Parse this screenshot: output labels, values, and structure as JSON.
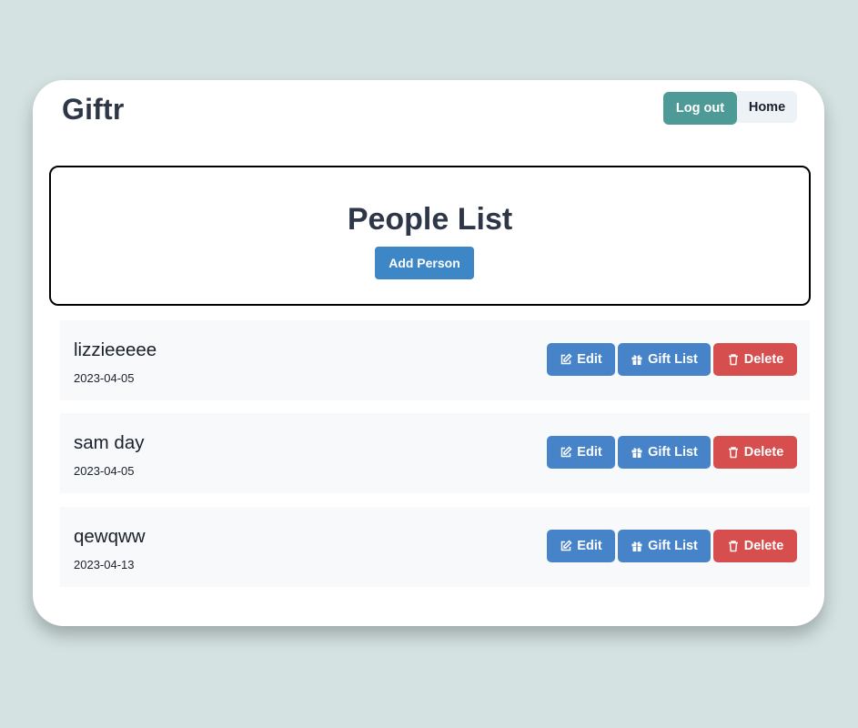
{
  "app": {
    "title": "Giftr"
  },
  "nav": {
    "logout_label": "Log out",
    "home_label": "Home"
  },
  "hero": {
    "title": "People List",
    "add_label": "Add Person"
  },
  "people": [
    {
      "name": "lizzieeeee",
      "date": "2023-04-05"
    },
    {
      "name": "sam day",
      "date": "2023-04-05"
    },
    {
      "name": "qewqww",
      "date": "2023-04-13"
    }
  ],
  "actions": {
    "edit_label": "Edit",
    "gift_label": "Gift List",
    "delete_label": "Delete"
  },
  "icons": {
    "edit": "edit-icon",
    "gift": "gift-icon",
    "delete": "trash-icon"
  },
  "colors": {
    "page_bg": "#d4e2e2",
    "logout": "#4d9a97",
    "primary": "#3d87c7",
    "action_blue": "#4683c9",
    "danger": "#d64e4e",
    "row_bg": "#f7f9fb"
  }
}
